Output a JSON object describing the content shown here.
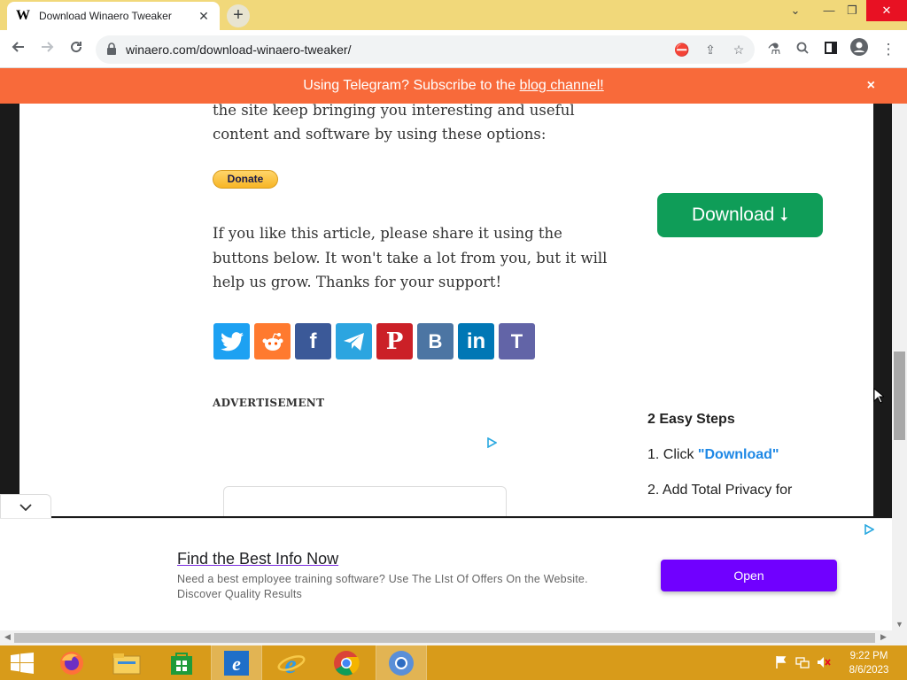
{
  "browser": {
    "tab_title": "Download Winaero Tweaker",
    "favicon_letter": "W",
    "url": "winaero.com/download-winaero-tweaker/"
  },
  "banner": {
    "text": "Using Telegram? Subscribe to the ",
    "link": "blog channel!",
    "close": "×"
  },
  "article": {
    "intro": "the site keep bringing you interesting and useful content and software by using these options:",
    "donate_label": "Donate",
    "share_prompt": "If you like this article, please share it using the buttons below. It won't take a lot from you, but it will help us grow. Thanks for your support!",
    "advertisement_label": "ADVERTISEMENT"
  },
  "share_buttons": [
    {
      "name": "twitter",
      "color": "#1da1f2"
    },
    {
      "name": "reddit",
      "color": "#ff7a2f"
    },
    {
      "name": "facebook",
      "color": "#3b5998"
    },
    {
      "name": "telegram",
      "color": "#2ca5e0"
    },
    {
      "name": "pinterest",
      "color": "#cb2027"
    },
    {
      "name": "vk",
      "color": "#4c75a3"
    },
    {
      "name": "linkedin",
      "color": "#0077b5"
    },
    {
      "name": "teams",
      "color": "#6264a7"
    }
  ],
  "sidebar": {
    "download_label": "Download ⭣",
    "steps_heading": "2 Easy Steps",
    "step1_prefix": "1. Click ",
    "step1_link": "\"Download\"",
    "step2": "2. Add Total Privacy for"
  },
  "anchor_ad": {
    "headline": "Find the Best Info Now",
    "description": "Need a best employee training software? Use The LIst Of Offers On the Website. Discover Quality Results",
    "button": "Open"
  },
  "taskbar": {
    "time": "9:22 PM",
    "date": "8/6/2023"
  }
}
